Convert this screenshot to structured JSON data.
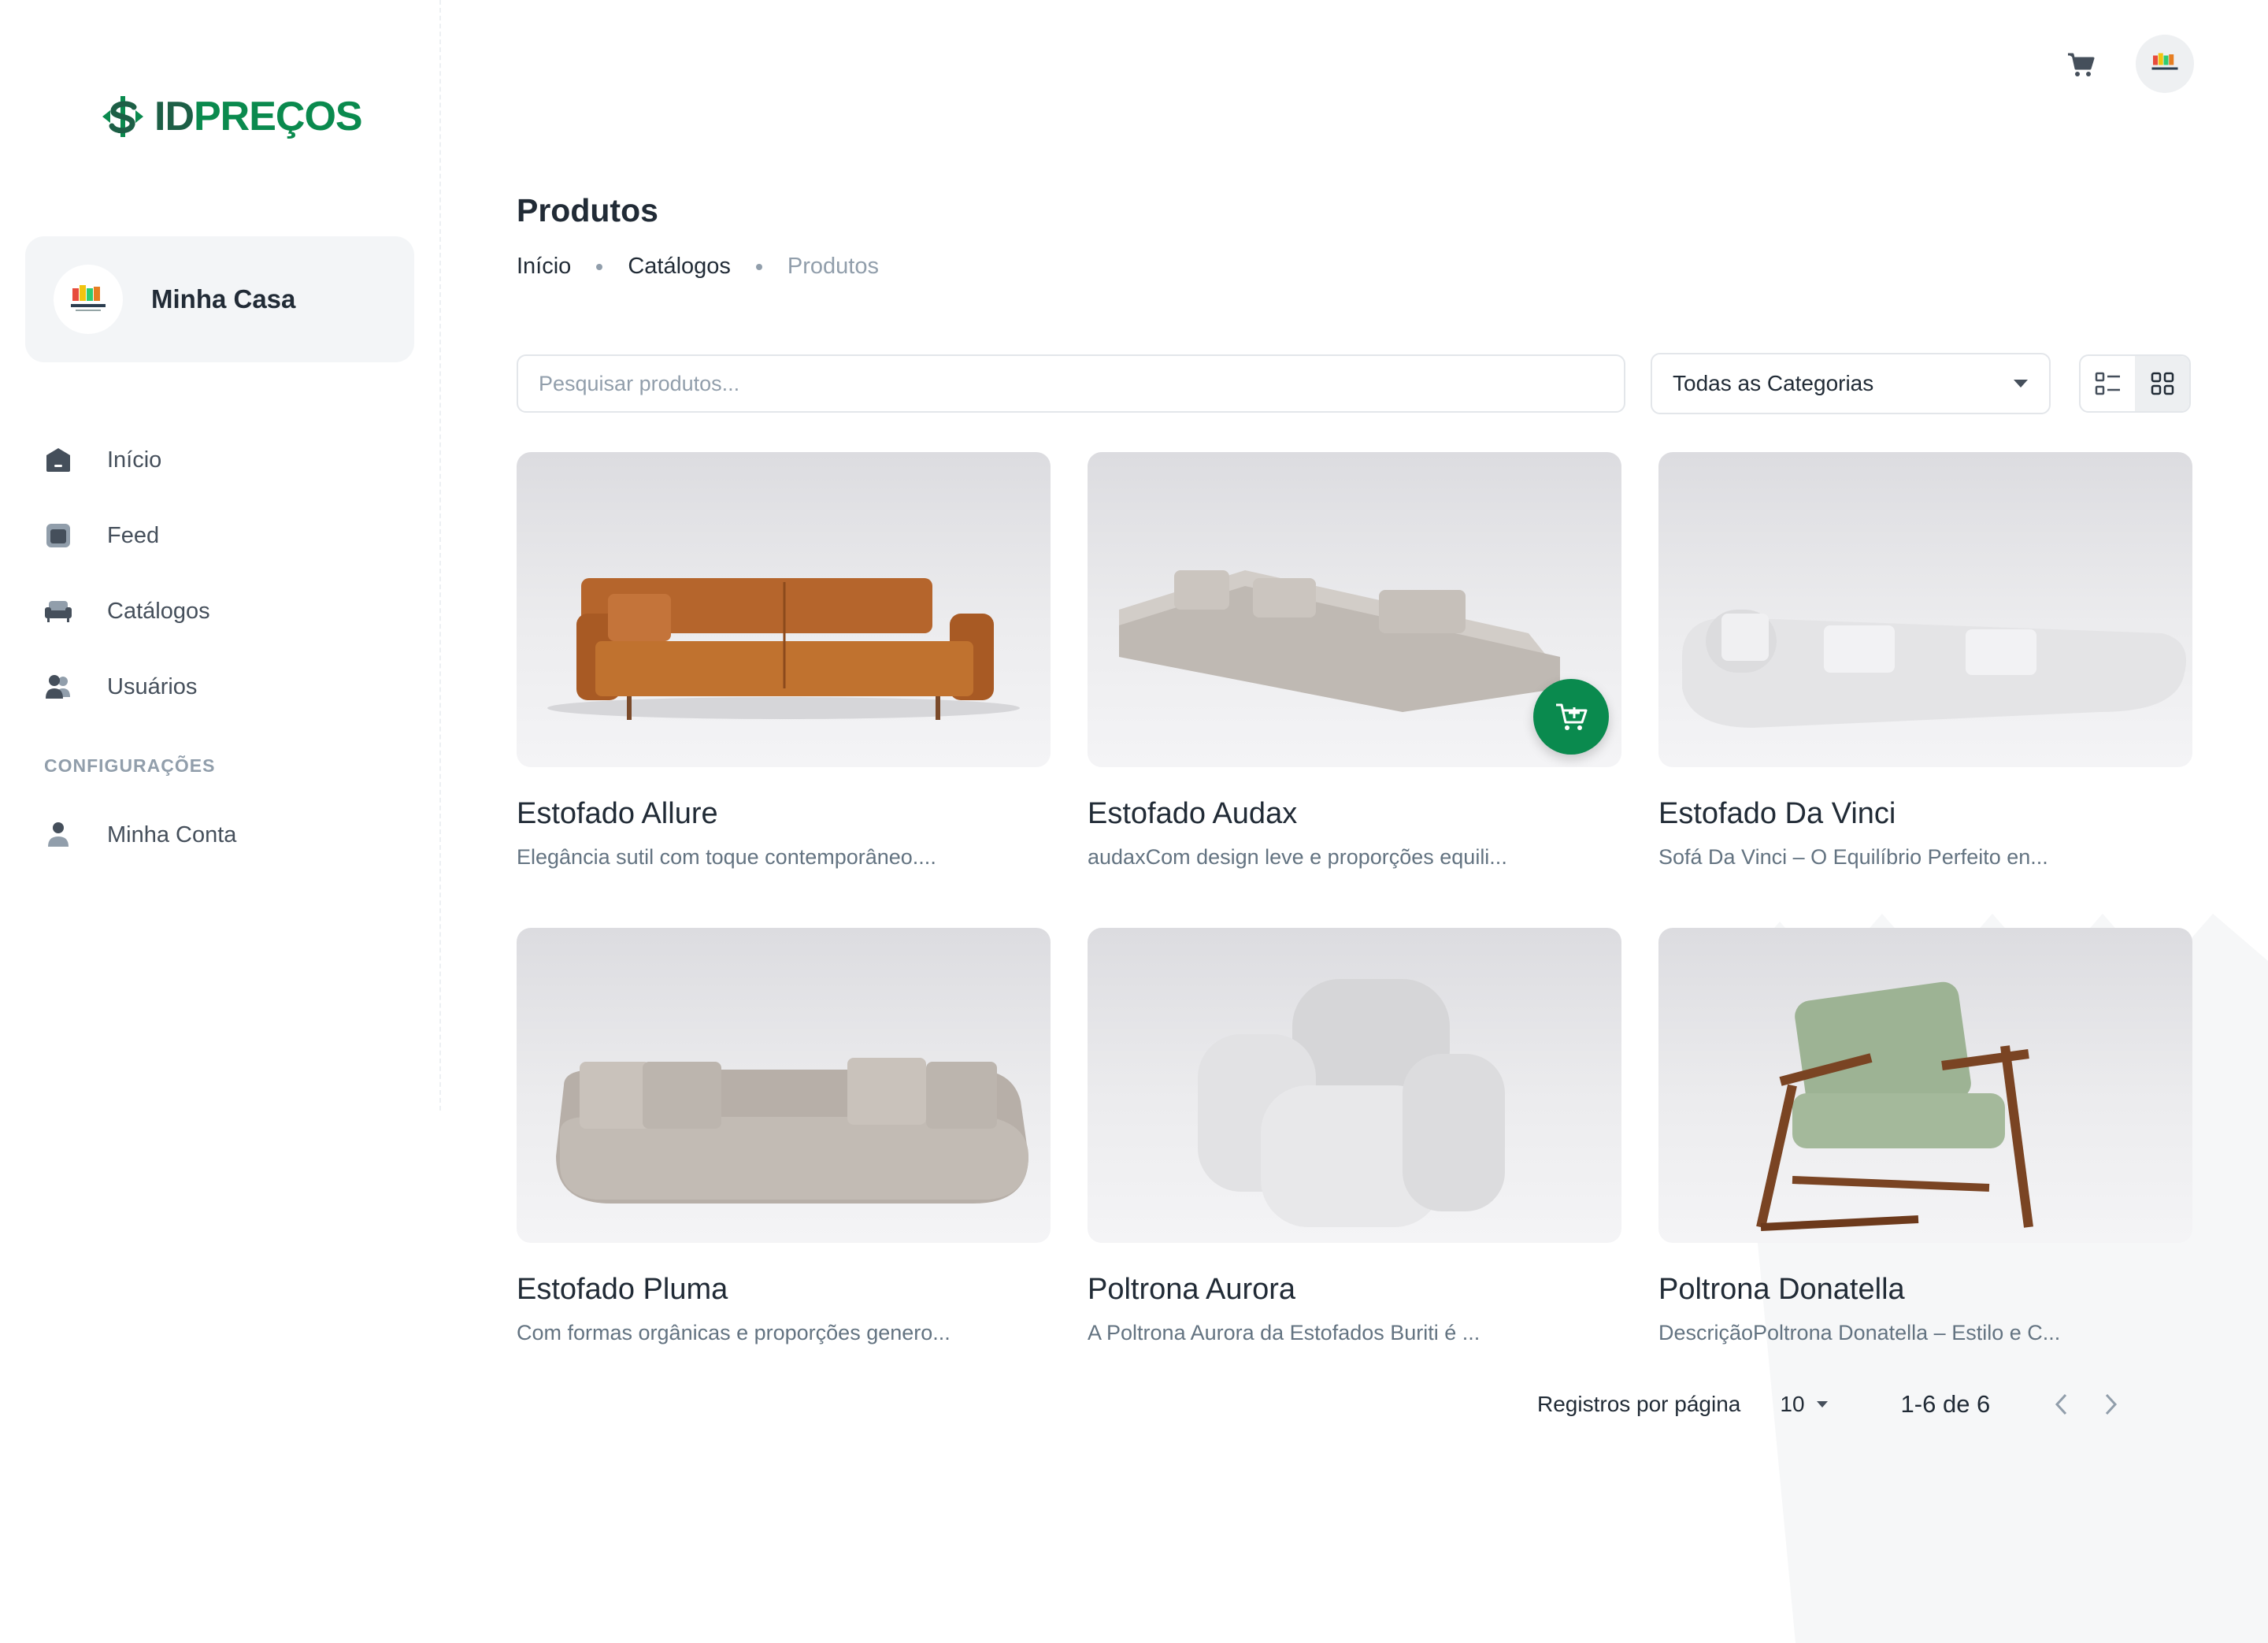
{
  "brand": {
    "logo_part1": "ID",
    "logo_part2": "PREÇOS"
  },
  "account": {
    "name": "Minha Casa",
    "avatar": "furniture-logo"
  },
  "sidebar": {
    "items": [
      {
        "label": "Início",
        "icon": "home-icon"
      },
      {
        "label": "Feed",
        "icon": "feed-icon"
      },
      {
        "label": "Catálogos",
        "icon": "sofa-icon"
      },
      {
        "label": "Usuários",
        "icon": "users-icon"
      }
    ],
    "section_label": "CONFIGURAÇÕES",
    "settings_items": [
      {
        "label": "Minha Conta",
        "icon": "user-icon"
      }
    ]
  },
  "page": {
    "title": "Produtos",
    "breadcrumb": [
      "Início",
      "Catálogos",
      "Produtos"
    ]
  },
  "filters": {
    "search_placeholder": "Pesquisar produtos...",
    "category_selected": "Todas as Categorias",
    "view_mode": "grid"
  },
  "products": [
    {
      "title": "Estofado Allure",
      "description": "Elegância sutil com toque contemporâneo....",
      "image": "brown-leather-sofa"
    },
    {
      "title": "Estofado Audax",
      "description": "audaxCom design leve e proporções equili...",
      "image": "gray-sectional-sofa"
    },
    {
      "title": "Estofado Da Vinci",
      "description": "Sofá Da Vinci – O Equilíbrio Perfeito en...",
      "image": "white-curved-sofa"
    },
    {
      "title": "Estofado Pluma",
      "description": "Com formas orgânicas e proporções genero...",
      "image": "taupe-curved-sofa"
    },
    {
      "title": "Poltrona Aurora",
      "description": "A Poltrona Aurora da Estofados Buriti é ...",
      "image": "white-armchair"
    },
    {
      "title": "Poltrona Donatella",
      "description": "DescriçãoPoltrona Donatella – Estilo e C...",
      "image": "wood-green-armchair"
    }
  ],
  "pagination": {
    "rows_label": "Registros por página",
    "rows_per_page": "10",
    "range": "1-6 de 6"
  },
  "colors": {
    "brand_green": "#0a8a4e",
    "text_primary": "#212b36",
    "text_secondary": "#637381"
  }
}
